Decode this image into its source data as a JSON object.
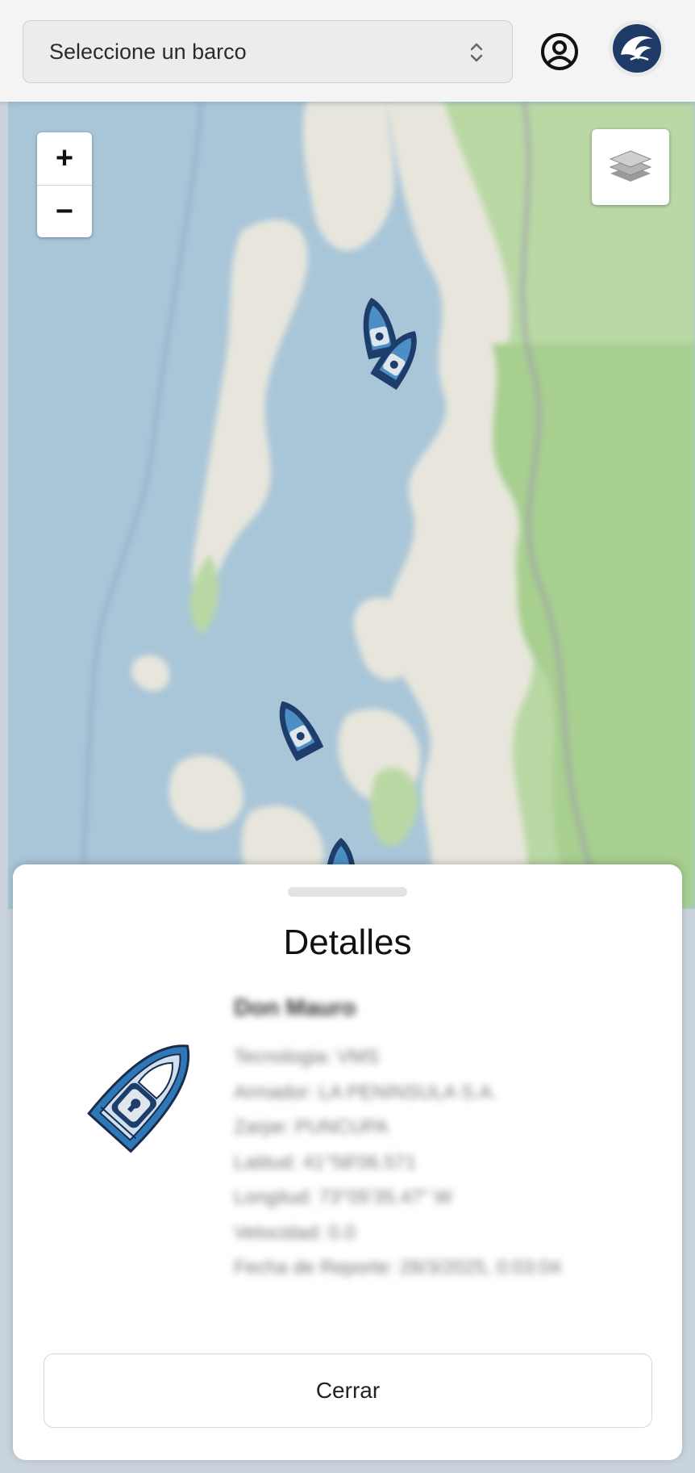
{
  "header": {
    "select_value": "Seleccione un barco",
    "chevron_icon": "chevron-up-down-icon",
    "user_icon": "user-circle-icon",
    "logo_icon": "dolphin-logo-icon"
  },
  "map": {
    "zoom_in_label": "+",
    "zoom_out_label": "−",
    "layers_icon": "layers-icon",
    "boat_icon": "boat-marker-icon"
  },
  "sheet": {
    "title": "Detalles",
    "boat_name": "Don Mauro",
    "details": [
      "Tecnologia: VMS",
      "Armador: LA PENINSULA S.A.",
      "Zarpe: PUNCUPA",
      "Latitud: 41°58'06.571",
      "Longitud: 73°05'35.47\" W",
      "Velocidad: 0.0",
      "Fecha de Reporte: 28/3/2025, 0:03:04"
    ],
    "close_label": "Cerrar"
  },
  "colors": {
    "header_bg": "#f4f4f4",
    "sea": "#a9c6d8",
    "land": "#e8e6dc",
    "forest": "#b9d8a4",
    "boat_dark": "#1f3d6b",
    "boat_light": "#4b8fc4"
  }
}
